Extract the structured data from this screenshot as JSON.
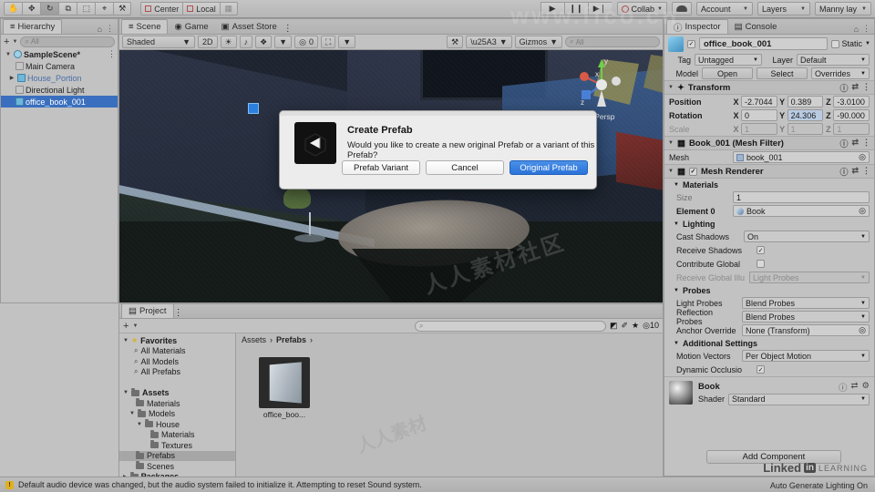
{
  "toolbar": {
    "tools": [
      {
        "name": "hand-tool",
        "glyph": "✋"
      },
      {
        "name": "move-tool",
        "glyph": "✥"
      },
      {
        "name": "rotate-tool",
        "glyph": "↻"
      },
      {
        "name": "scale-tool",
        "glyph": "⧉"
      },
      {
        "name": "rect-tool",
        "glyph": "⬚"
      },
      {
        "name": "transform-tool",
        "glyph": "⌖"
      },
      {
        "name": "custom-tool",
        "glyph": "⚒"
      }
    ],
    "pivot_label": "Center",
    "space_label": "Local",
    "play_glyph": "▶",
    "pause_glyph": "❙❙",
    "step_glyph": "▶❘",
    "collab_label": "Collab",
    "account_label": "Account",
    "layers_label": "Layers",
    "layout_label": "Manny lay"
  },
  "hierarchy": {
    "tab_label": "Hierarchy",
    "search_placeholder": "All",
    "plus_label": "+",
    "items": [
      {
        "label": "SampleScene*",
        "depth": 0,
        "icon": "scene-icon",
        "bold": true,
        "expanded": true,
        "selected": false
      },
      {
        "label": "Main Camera",
        "depth": 1,
        "icon": "gameobject-icon",
        "bold": false,
        "expanded": false,
        "selected": false
      },
      {
        "label": "House_Portion",
        "depth": 1,
        "icon": "prefab-icon",
        "bold": false,
        "expanded": false,
        "selected": false,
        "arrow": "▶"
      },
      {
        "label": "Directional Light",
        "depth": 1,
        "icon": "gameobject-icon",
        "bold": false,
        "expanded": false,
        "selected": false
      },
      {
        "label": "office_book_001",
        "depth": 1,
        "icon": "prefab-icon",
        "bold": false,
        "expanded": false,
        "selected": true
      }
    ]
  },
  "sceneview": {
    "tabs": [
      {
        "label": "Scene",
        "active": true
      },
      {
        "label": "Game",
        "active": false
      },
      {
        "label": "Asset Store",
        "active": false
      }
    ],
    "draw_mode": "Shaded",
    "view_2d": "2D",
    "gizmos_label": "Gizmos",
    "gizmo_search_placeholder": "All",
    "audio_count": "0",
    "persp_label": "Persp",
    "axis_x": "x",
    "axis_y": "y",
    "axis_z": "z"
  },
  "dialog": {
    "title": "Create Prefab",
    "message": "Would you like to create a new original Prefab or a variant of this Prefab?",
    "buttons": [
      {
        "label": "Prefab Variant",
        "primary": false
      },
      {
        "label": "Cancel",
        "primary": false
      },
      {
        "label": "Original Prefab",
        "primary": true
      }
    ],
    "accent_color": "#2a73d8",
    "icon_name": "unity-logo-icon"
  },
  "project": {
    "tab_label": "Project",
    "plus_label": "+",
    "search_placeholder": "",
    "favorites_count": "10",
    "breadcrumb": [
      "Assets",
      "Prefabs",
      ""
    ],
    "tree": [
      {
        "label": "Favorites",
        "depth": 0,
        "icon": "star-icon",
        "bold": true,
        "expanded": true,
        "selected": false
      },
      {
        "label": "All Materials",
        "depth": 1,
        "icon": "search-icon",
        "bold": false,
        "selected": false
      },
      {
        "label": "All Models",
        "depth": 1,
        "icon": "search-icon",
        "bold": false,
        "selected": false
      },
      {
        "label": "All Prefabs",
        "depth": 1,
        "icon": "search-icon",
        "bold": false,
        "selected": false
      },
      {
        "label": "",
        "depth": 0,
        "icon": "spacer",
        "bold": false,
        "selected": false
      },
      {
        "label": "Assets",
        "depth": 0,
        "icon": "folder-icon",
        "bold": true,
        "expanded": true,
        "selected": false
      },
      {
        "label": "Materials",
        "depth": 1,
        "icon": "folder-icon",
        "bold": false,
        "selected": false
      },
      {
        "label": "Models",
        "depth": 1,
        "icon": "folder-icon",
        "bold": false,
        "expanded": true,
        "selected": false
      },
      {
        "label": "House",
        "depth": 2,
        "icon": "folder-icon",
        "bold": false,
        "expanded": true,
        "selected": false
      },
      {
        "label": "Materials",
        "depth": 3,
        "icon": "folder-icon",
        "bold": false,
        "selected": false
      },
      {
        "label": "Textures",
        "depth": 3,
        "icon": "folder-icon",
        "bold": false,
        "selected": false
      },
      {
        "label": "Prefabs",
        "depth": 1,
        "icon": "folder-icon",
        "bold": false,
        "selected": true
      },
      {
        "label": "Scenes",
        "depth": 1,
        "icon": "folder-icon",
        "bold": false,
        "selected": false
      },
      {
        "label": "Packages",
        "depth": 0,
        "icon": "folder-icon",
        "bold": true,
        "expanded": false,
        "selected": false
      }
    ],
    "assets": [
      {
        "label": "office_boo...",
        "name": "office_book_001"
      }
    ]
  },
  "inspector": {
    "tabs": [
      {
        "label": "Inspector",
        "active": true
      },
      {
        "label": "Console",
        "active": false
      }
    ],
    "object_name": "office_book_001",
    "enabled": true,
    "static_label": "Static",
    "tag_label": "Tag",
    "tag_value": "Untagged",
    "layer_label": "Layer",
    "layer_value": "Default",
    "model_label": "Model",
    "open_label": "Open",
    "select_label": "Select",
    "overrides_label": "Overrides",
    "transform": {
      "title": "Transform",
      "rows": [
        {
          "label": "Position",
          "x": "-2.7044",
          "y": "0.389",
          "z": "-3.0100",
          "dim": false,
          "hl_y": false
        },
        {
          "label": "Rotation",
          "x": "0",
          "y": "24.306",
          "z": "-90.000",
          "dim": false,
          "hl_y": true
        },
        {
          "label": "Scale",
          "x": "1",
          "y": "1",
          "z": "1",
          "dim": true,
          "hl_y": false
        }
      ],
      "axes": [
        "X",
        "Y",
        "Z"
      ]
    },
    "mesh_filter": {
      "title": "Book_001 (Mesh Filter)",
      "mesh_label": "Mesh",
      "mesh_value": "book_001"
    },
    "mesh_renderer": {
      "title": "Mesh Renderer",
      "enabled": true,
      "materials_label": "Materials",
      "size_label": "Size",
      "size_value": "1",
      "element_label": "Element 0",
      "element_value": "Book",
      "lighting_label": "Lighting",
      "cast_shadows_label": "Cast Shadows",
      "cast_shadows_value": "On",
      "receive_shadows_label": "Receive Shadows",
      "receive_shadows_checked": true,
      "contribute_global_label": "Contribute Global",
      "contribute_global_checked": false,
      "receive_gi_label": "Receive Global Illu",
      "receive_gi_value": "Light Probes",
      "probes_label": "Probes",
      "light_probes_label": "Light Probes",
      "light_probes_value": "Blend Probes",
      "reflection_probes_label": "Reflection Probes",
      "reflection_probes_value": "Blend Probes",
      "anchor_override_label": "Anchor Override",
      "anchor_override_value": "None (Transform)",
      "additional_settings_label": "Additional Settings",
      "motion_vectors_label": "Motion Vectors",
      "motion_vectors_value": "Per Object Motion",
      "dynamic_occlusion_label": "Dynamic Occlusio",
      "dynamic_occlusion_checked": true
    },
    "material": {
      "name": "Book",
      "shader_label": "Shader",
      "shader_value": "Standard"
    },
    "add_component_label": "Add Component"
  },
  "statusbar": {
    "message": "Default audio device was changed, but the audio system failed to initialize it. Attempting to reset Sound system.",
    "right_message": "Auto Generate Lighting On",
    "watermark_brand": "Linked",
    "watermark_in": "in",
    "watermark_learning": "LEARNING"
  }
}
